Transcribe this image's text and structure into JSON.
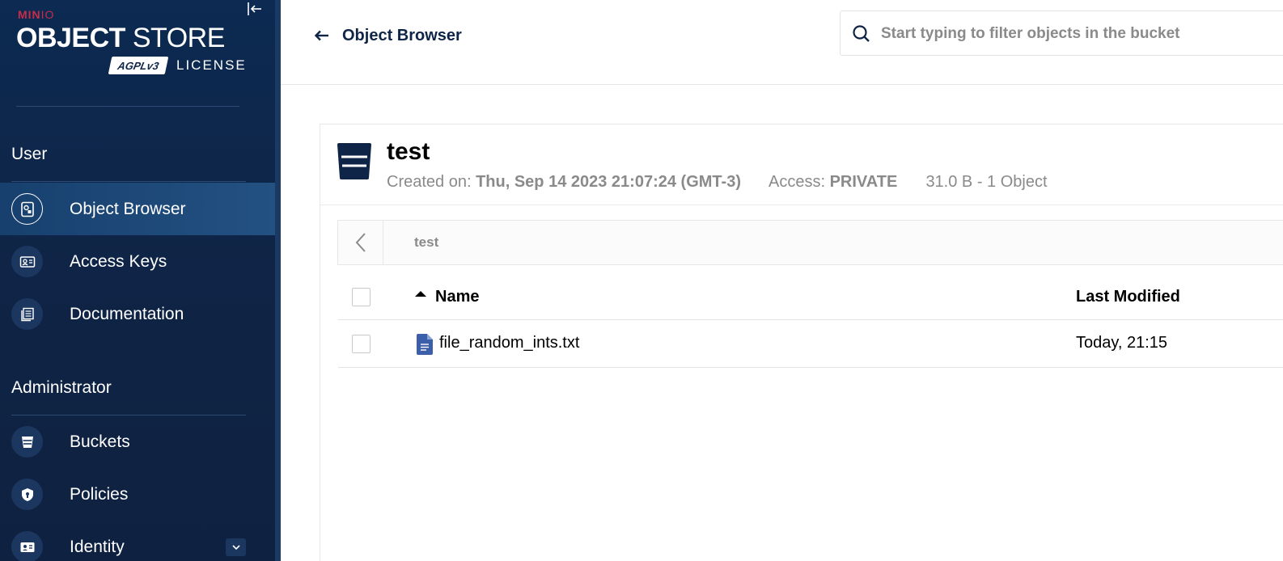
{
  "sidebar": {
    "logo": {
      "minio": "MIN",
      "minio_io": "IO",
      "title_bold": "OBJECT",
      "title_light": " STORE",
      "agpl": "AGPLv3",
      "license": "LICENSE"
    },
    "sections": {
      "user": "User",
      "administrator": "Administrator"
    },
    "items": [
      {
        "label": "Object Browser",
        "icon": "object-browser-icon",
        "active": true
      },
      {
        "label": "Access Keys",
        "icon": "access-keys-icon"
      },
      {
        "label": "Documentation",
        "icon": "documentation-icon"
      },
      {
        "label": "Buckets",
        "icon": "bucket-icon"
      },
      {
        "label": "Policies",
        "icon": "shield-icon"
      },
      {
        "label": "Identity",
        "icon": "identity-icon",
        "expandable": true
      }
    ]
  },
  "header": {
    "title": "Object Browser",
    "search_placeholder": "Start typing to filter objects in the bucket"
  },
  "bucket": {
    "name": "test",
    "created_label": "Created on:",
    "created_value": "Thu, Sep 14 2023 21:07:24 (GMT-3)",
    "access_label": "Access:",
    "access_value": "PRIVATE",
    "summary": "31.0 B - 1 Object"
  },
  "breadcrumb": {
    "path": "test"
  },
  "table": {
    "columns": {
      "name": "Name",
      "last_modified": "Last Modified"
    },
    "rows": [
      {
        "name": "file_random_ints.txt",
        "last_modified": "Today, 21:15"
      }
    ]
  },
  "colors": {
    "sidebar_bg": "#0f2547",
    "active_item": "#235182",
    "brand_red": "#c72c48",
    "file_icon": "#3b5fa8"
  }
}
